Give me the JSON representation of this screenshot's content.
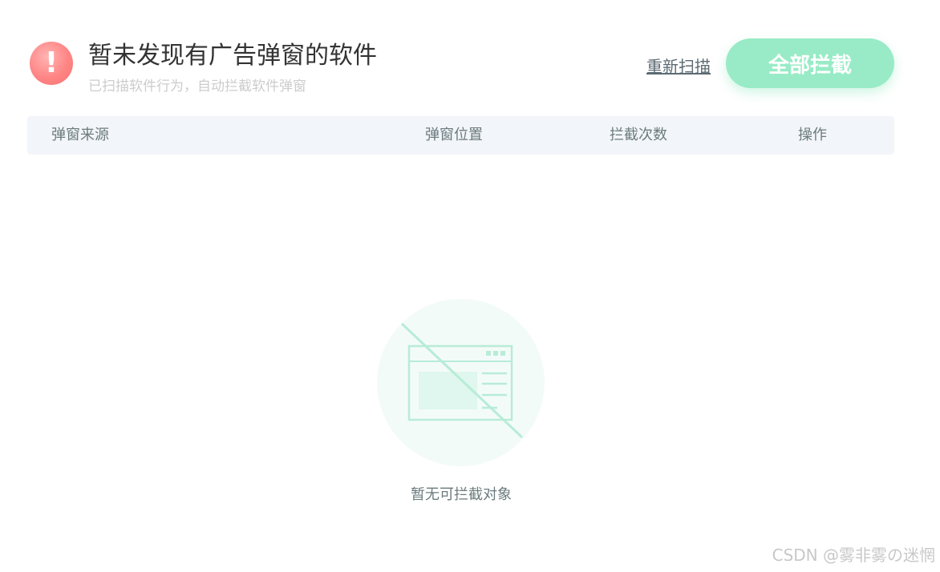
{
  "header": {
    "title": "暂未发现有广告弹窗的软件",
    "subtitle": "已扫描软件行为，自动拦截软件弹窗",
    "alert_symbol": "!",
    "rescan_label": "重新扫描",
    "block_all_label": "全部拦截"
  },
  "table": {
    "columns": [
      "弹窗来源",
      "弹窗位置",
      "拦截次数",
      "操作"
    ]
  },
  "empty_state": {
    "text": "暂无可拦截对象",
    "icon": "blocked-window-icon"
  },
  "watermark": "CSDN @雾非雾の迷惘",
  "colors": {
    "accent": "#98ebc6",
    "alert": "#ff8585",
    "illustration": "#b8ecd8",
    "table_header_bg": "#f2f5f9"
  }
}
